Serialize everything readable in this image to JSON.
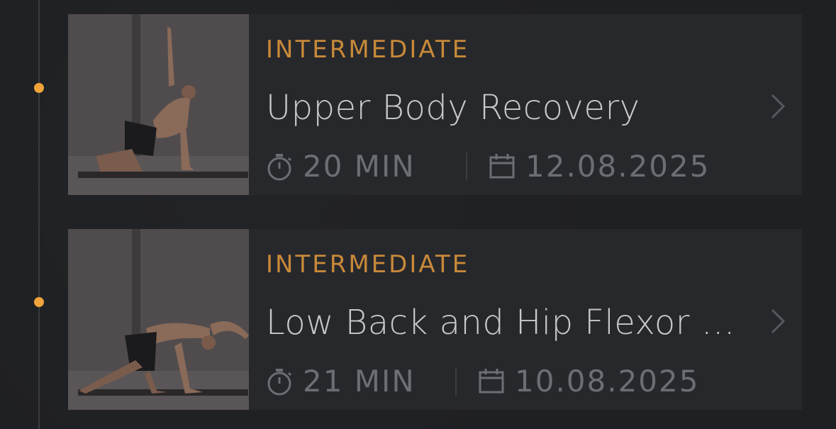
{
  "timeline": {
    "dot_color": "#f0a43a"
  },
  "workouts": [
    {
      "level": "INTERMEDIATE",
      "title": "Upper Body Recovery",
      "duration": "20 MIN",
      "date": "12.08.2025",
      "duration_icon": "stopwatch-icon",
      "date_icon": "calendar-icon",
      "action_icon": "chevron-right-icon"
    },
    {
      "level": "INTERMEDIATE",
      "title": "Low Back and Hip Flexor Release",
      "duration": "21 MIN",
      "date": "10.08.2025",
      "duration_icon": "stopwatch-icon",
      "date_icon": "calendar-icon",
      "action_icon": "chevron-right-icon"
    }
  ],
  "colors": {
    "accent": "#c8893a",
    "title": "#c9c9cb",
    "meta": "#6b6e74",
    "card": "#27282b"
  }
}
